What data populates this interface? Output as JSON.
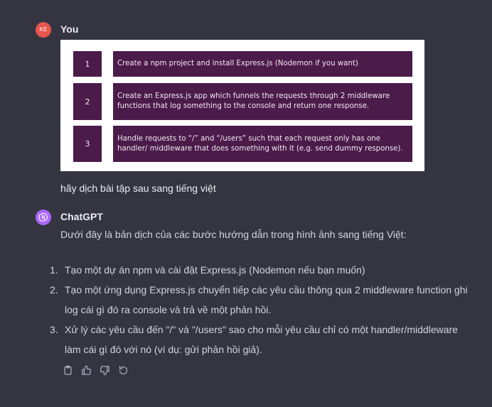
{
  "user": {
    "avatar_initials": "KE",
    "name": "You",
    "image_steps": [
      {
        "num": "1",
        "text": "Create a npm project and install Express.js (Nodemon if you want)"
      },
      {
        "num": "2",
        "text": "Create an Express.js app which funnels the requests through 2 middleware functions that log something to the console and return one response."
      },
      {
        "num": "3",
        "text": "Handle requests to “/” and “/users” such that each request only has one handler/ middleware that does something with it (e.g. send dummy response)."
      }
    ],
    "message": "hãy dịch bài tập sau sang tiếng việt"
  },
  "assistant": {
    "name": "ChatGPT",
    "intro": "Dưới đây là bản dịch của các bước hướng dẫn trong hình ảnh sang tiếng Việt:",
    "items": [
      {
        "num": "1.",
        "text": "Tạo một dự án npm và cài đặt Express.js (Nodemon nếu bạn muốn)"
      },
      {
        "num": "2.",
        "text": "Tạo một ứng dụng Express.js chuyển tiếp các yêu cầu thông qua 2 middleware function ghi log cái gì đó ra console và trả về một phản hồi."
      },
      {
        "num": "3.",
        "text": "Xử lý các yêu cầu đến \"/\" và \"/users\" sao cho mỗi yêu cầu chỉ có một handler/middleware làm cái gì đó với nó (ví dụ: gửi phản hồi giả)."
      }
    ]
  },
  "icons": {
    "copy": "clipboard-icon",
    "like": "thumbs-up-icon",
    "dislike": "thumbs-down-icon",
    "regenerate": "regenerate-icon"
  },
  "colors": {
    "background": "#343541",
    "user_avatar": "#e8554e",
    "gpt_avatar": "#ab68ff",
    "step_box": "#4b1b4a"
  }
}
